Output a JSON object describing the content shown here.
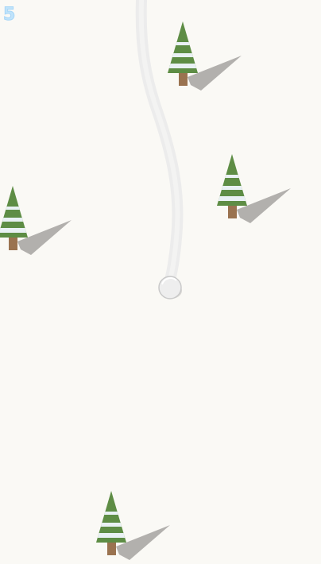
{
  "hud": {
    "score": "5"
  },
  "colors": {
    "snow_background": "#faf9f5",
    "trail": "#ececec",
    "ball_fill": "#eeeeee",
    "ball_outline": "#c9c9c9",
    "tree_foliage": "#5e8d45",
    "tree_snow_band": "#e9f1f4",
    "tree_trunk": "#9a7350",
    "tree_shadow": "#b2b0ad",
    "score_text": "#bfe3fb"
  },
  "icons": {
    "player": "snowball-icon",
    "obstacle": "pine-tree-icon"
  },
  "obstacles_count_label": "",
  "trees": [
    {
      "name": "pine-tree-1"
    },
    {
      "name": "pine-tree-2"
    },
    {
      "name": "pine-tree-3"
    },
    {
      "name": "pine-tree-4"
    }
  ]
}
